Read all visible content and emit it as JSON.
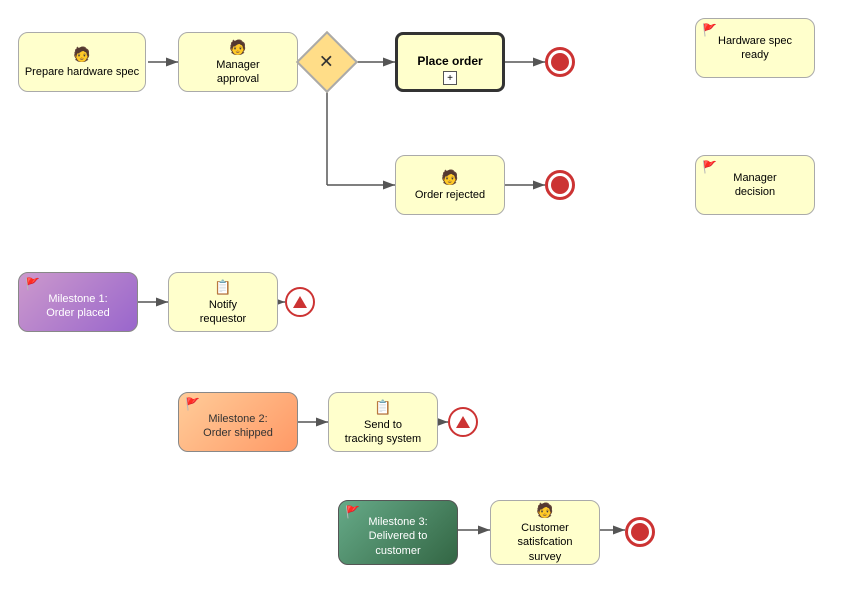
{
  "nodes": {
    "prepare": {
      "label": "Prepare\nhardware spec",
      "type": "task-yellow",
      "icon": "person"
    },
    "manager_approval": {
      "label": "Manager\napproval",
      "type": "task-yellow",
      "icon": "person"
    },
    "place_order": {
      "label": "Place order",
      "type": "task-bold",
      "icon": ""
    },
    "order_rejected": {
      "label": "Order rejected",
      "type": "task-yellow",
      "icon": "person"
    },
    "notify_requestor": {
      "label": "Notify\nrequestor",
      "type": "task-yellow",
      "icon": "script"
    },
    "send_tracking": {
      "label": "Send to\ntracking system",
      "type": "task-yellow",
      "icon": "script"
    },
    "customer_survey": {
      "label": "Customer\nsatisfcation\nsurvey",
      "type": "task-yellow",
      "icon": "person"
    },
    "milestone1": {
      "label": "Milestone 1:\nOrder placed",
      "type": "milestone-purple"
    },
    "milestone2": {
      "label": "Milestone 2:\nOrder shipped",
      "type": "milestone-orange"
    },
    "milestone3": {
      "label": "Milestone 3:\nDelivered to\ncustomer",
      "type": "milestone-green"
    },
    "hw_ready": {
      "label": "Hardware spec\nready",
      "type": "task-yellow",
      "flag": true
    },
    "manager_decision": {
      "label": "Manager\ndecision",
      "type": "task-yellow",
      "flag": true
    }
  }
}
